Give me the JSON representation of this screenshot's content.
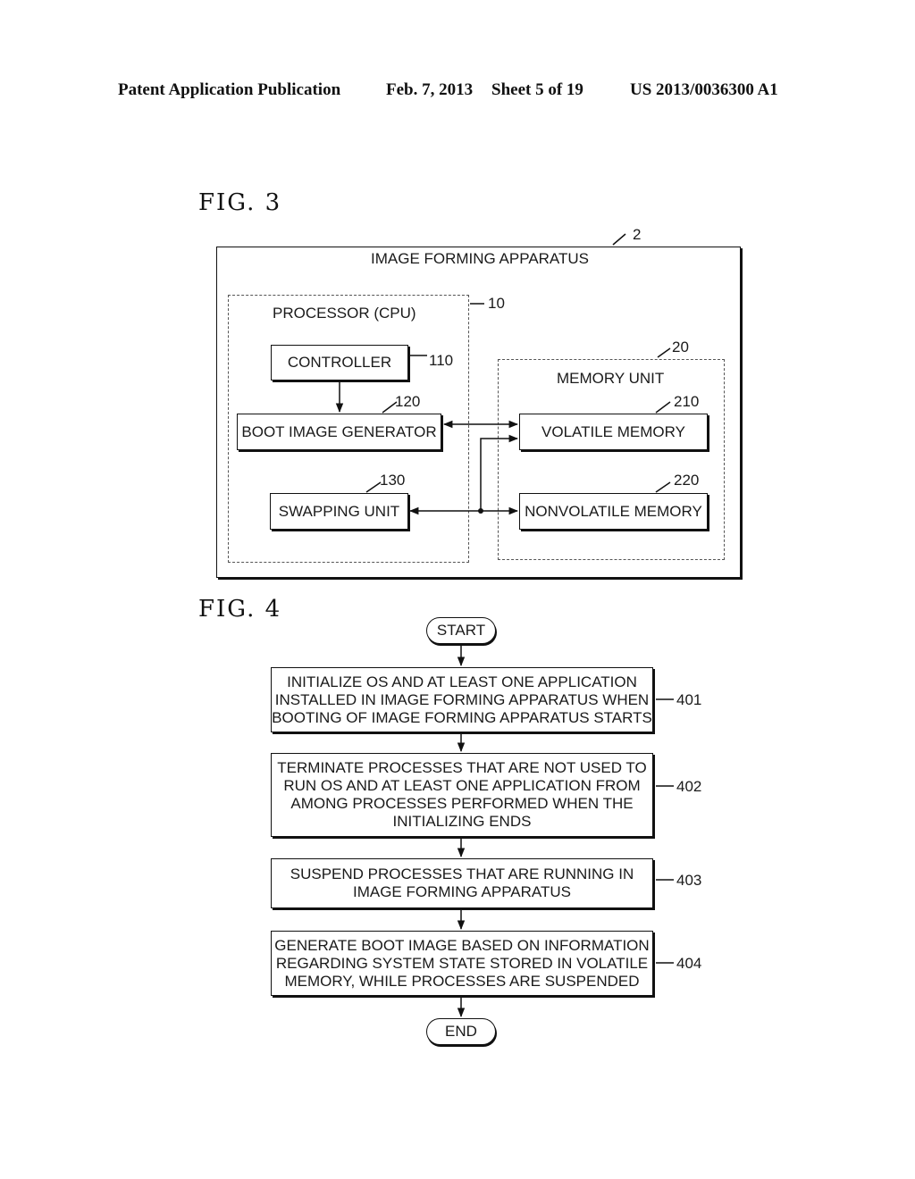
{
  "header": {
    "publication": "Patent Application Publication",
    "date": "Feb. 7, 2013",
    "sheet": "Sheet 5 of 19",
    "number": "US 2013/0036300 A1"
  },
  "fig3": {
    "title": "FIG. 3",
    "apparatus": {
      "label": "IMAGE FORMING APPARATUS",
      "ref": "2"
    },
    "processor": {
      "label": "PROCESSOR (CPU)",
      "ref": "10"
    },
    "controller": {
      "label": "CONTROLLER",
      "ref": "110"
    },
    "boot_image_generator": {
      "label": "BOOT IMAGE GENERATOR",
      "ref": "120"
    },
    "swapping_unit": {
      "label": "SWAPPING UNIT",
      "ref": "130"
    },
    "memory_unit": {
      "label": "MEMORY UNIT",
      "ref": "20"
    },
    "volatile_memory": {
      "label": "VOLATILE MEMORY",
      "ref": "210"
    },
    "nonvolatile_memory": {
      "label": "NONVOLATILE MEMORY",
      "ref": "220"
    }
  },
  "fig4": {
    "title": "FIG. 4",
    "start": "START",
    "end": "END",
    "steps": [
      {
        "ref": "401",
        "text": "INITIALIZE OS AND AT LEAST ONE APPLICATION\nINSTALLED IN IMAGE FORMING APPARATUS WHEN\nBOOTING OF IMAGE FORMING APPARATUS STARTS"
      },
      {
        "ref": "402",
        "text": "TERMINATE PROCESSES THAT ARE NOT USED TO\nRUN OS AND AT LEAST ONE APPLICATION FROM\nAMONG PROCESSES PERFORMED WHEN THE\nINITIALIZING ENDS"
      },
      {
        "ref": "403",
        "text": "SUSPEND PROCESSES THAT ARE RUNNING IN\nIMAGE FORMING APPARATUS"
      },
      {
        "ref": "404",
        "text": "GENERATE BOOT IMAGE BASED ON INFORMATION\nREGARDING SYSTEM STATE STORED IN VOLATILE\nMEMORY, WHILE PROCESSES ARE SUSPENDED"
      }
    ]
  }
}
